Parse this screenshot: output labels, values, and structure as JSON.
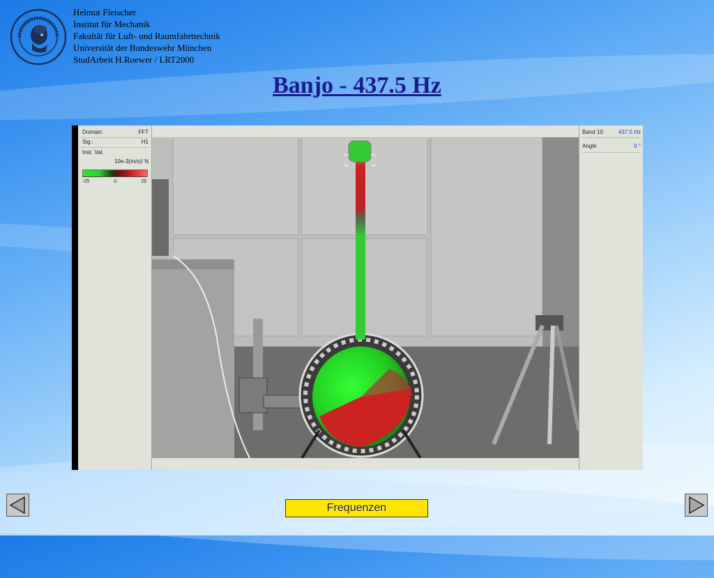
{
  "header": {
    "lines": [
      "Helmut Fleischer",
      "Institut für Mechanik",
      "Fakultät für Luft- und Raumfahrttechnik",
      "Universität der Bundeswehr München",
      "StudArbeit H.Roewer / LRT2000"
    ],
    "logo_text_top": "UNIVERSITÄT DER BUNDESWEHR",
    "logo_text_bottom": "MÜNCHEN"
  },
  "title": "Banjo - 437.5 Hz",
  "left_panel": {
    "domain_label": "Domain:",
    "domain_value": "FFT",
    "signal_label": "Sig.:",
    "signal_value": "H1",
    "inst_label": "Inst. Val.",
    "unit": "10e-3(m/s)/ N",
    "scale_min": "-25",
    "scale_mid": "0",
    "scale_max": "25"
  },
  "right_panel": {
    "band_label": "Band 10",
    "band_value": "437.5 Hz",
    "angle_label": "Angle",
    "angle_value": "0 °"
  },
  "colors": {
    "title": "#1b1b8c",
    "button_fill": "#ffe600",
    "accent_value": "#2233dd",
    "positive": "#cc2222",
    "negative": "#22cc22"
  },
  "navigation": {
    "prev_icon": "triangle-left-icon",
    "next_icon": "triangle-right-icon",
    "frequencies_button": "Frequenzen"
  }
}
